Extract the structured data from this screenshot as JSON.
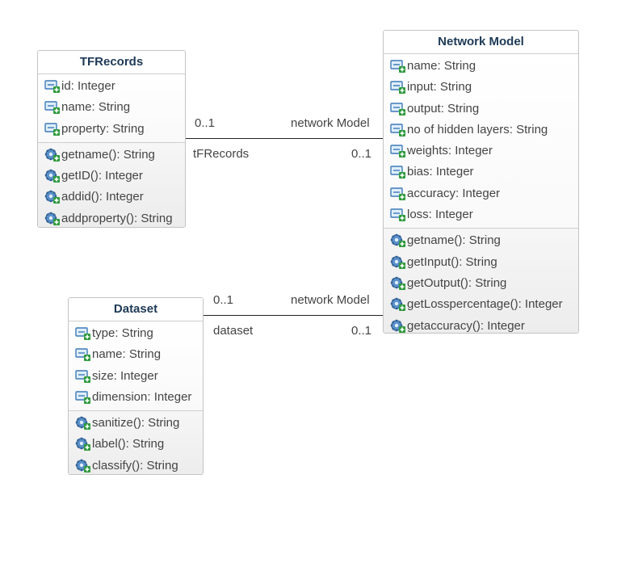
{
  "classes": {
    "tfrecords": {
      "name": "TFRecords",
      "attributes": [
        "id: Integer",
        "name: String",
        "property: String"
      ],
      "operations": [
        "getname(): String",
        "getID(): Integer",
        "addid(): Integer",
        "addproperty(): String"
      ]
    },
    "network": {
      "name": "Network Model",
      "attributes": [
        "name: String",
        "input: String",
        "output: String",
        "no of hidden layers: String",
        "weights: Integer",
        "bias: Integer",
        "accuracy: Integer",
        "loss: Integer"
      ],
      "operations": [
        "getname(): String",
        "getInput(): String",
        "getOutput(): String",
        "getLosspercentage(): Integer",
        "getaccuracy(): Integer"
      ]
    },
    "dataset": {
      "name": "Dataset",
      "attributes": [
        "type: String",
        "name: String",
        "size: Integer",
        "dimension: Integer"
      ],
      "operations": [
        "sanitize(): String",
        "label(): String",
        "classify(): String"
      ]
    }
  },
  "associations": [
    {
      "from_multiplicity": "0..1",
      "from_role": "tFRecords",
      "to_role": "network Model",
      "to_multiplicity": "0..1"
    },
    {
      "from_multiplicity": "0..1",
      "from_role": "dataset",
      "to_role": "network Model",
      "to_multiplicity": "0..1"
    }
  ],
  "icons": {
    "attribute": "attribute-icon",
    "operation": "operation-icon"
  },
  "colors": {
    "title": "#1e3a56",
    "border": "#c4c4c4",
    "text": "#444444",
    "icon_blue": "#3d7ab8",
    "icon_green": "#2e9a3c"
  }
}
